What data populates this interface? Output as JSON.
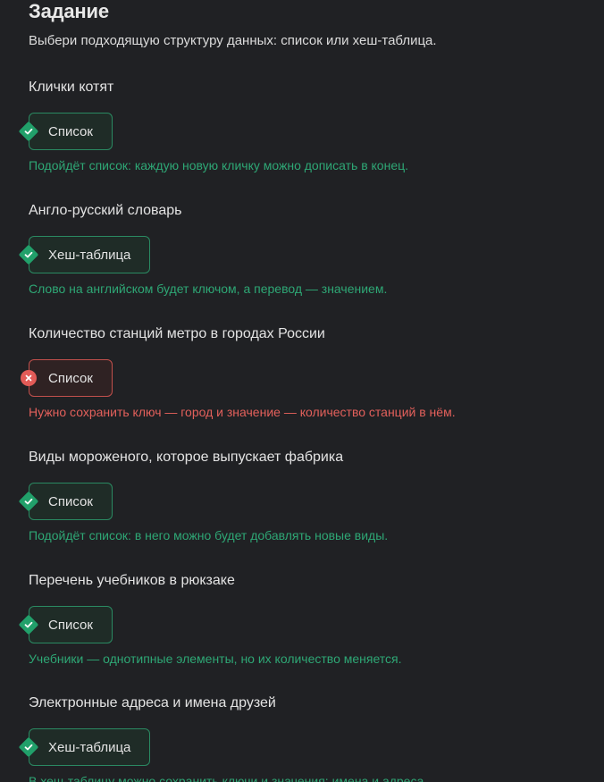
{
  "task": {
    "title": "Задание",
    "subtitle": "Выбери подходящую структуру данных: список или хеш-таблица."
  },
  "questions": [
    {
      "text": "Клички котят",
      "answer": "Список",
      "status": "correct",
      "feedback": "Подойдёт список: каждую новую кличку можно дописать в конец."
    },
    {
      "text": "Англо-русский словарь",
      "answer": "Хеш-таблица",
      "status": "correct",
      "feedback": "Слово на английском будет ключом, а перевод — значением."
    },
    {
      "text": "Количество станций метро в городах России",
      "answer": "Список",
      "status": "wrong",
      "feedback": "Нужно сохранить ключ — город и значение — количество станций в нём."
    },
    {
      "text": "Виды мороженого, которое выпускает фабрика",
      "answer": "Список",
      "status": "correct",
      "feedback": "Подойдёт список: в него можно будет добавлять новые виды."
    },
    {
      "text": "Перечень учебников в рюкзаке",
      "answer": "Список",
      "status": "correct",
      "feedback": "Учебники — однотипные элементы, но их количество меняется."
    },
    {
      "text": "Электронные адреса и имена друзей",
      "answer": "Хеш-таблица",
      "status": "correct",
      "feedback": "В хеш-таблицу можно сохранить ключи и значения: имена и адреса."
    }
  ],
  "colors": {
    "background": "#202124",
    "correct": "#21a06a",
    "correct_text": "#2ea775",
    "wrong": "#e35b57"
  },
  "icons": {
    "correct": "check-icon",
    "wrong": "cross-icon"
  }
}
